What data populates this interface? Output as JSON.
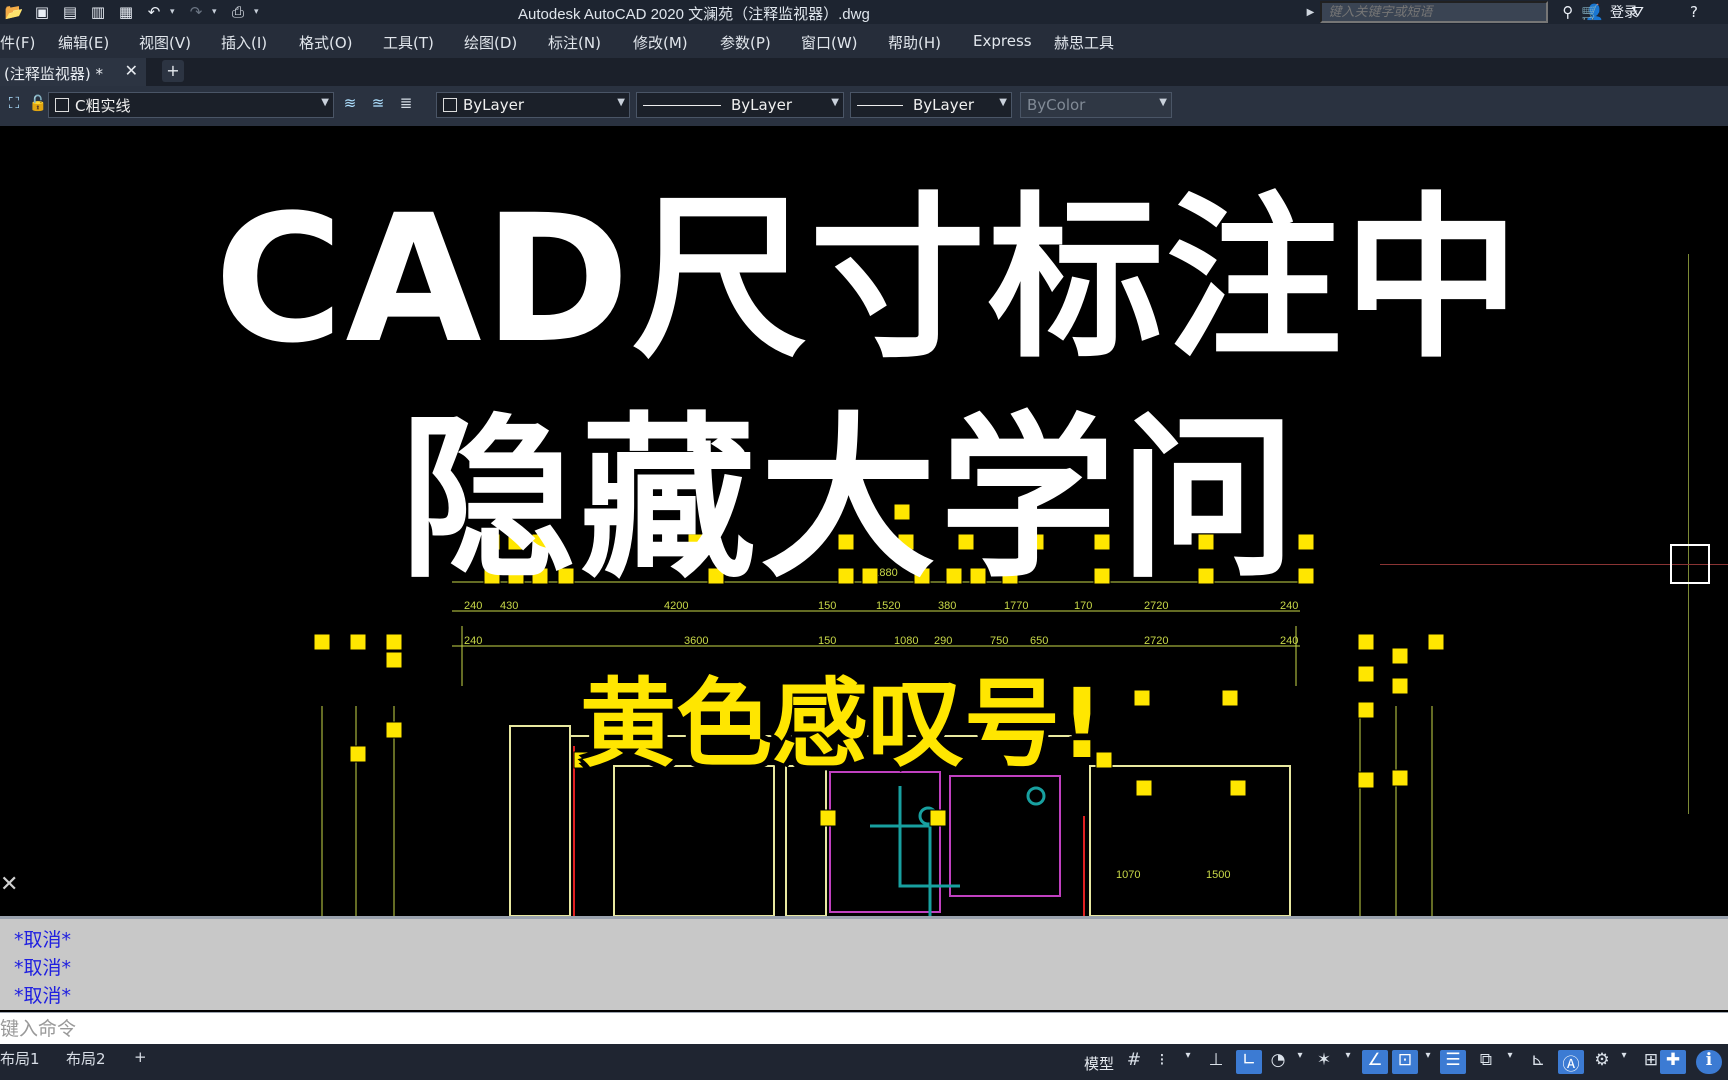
{
  "titlebar": {
    "title": "Autodesk AutoCAD 2020    文澜苑（注释监视器）.dwg",
    "search_placeholder": "键入关键字或短语",
    "login": "登录",
    "icons": [
      "open-icon",
      "save-icon",
      "saveas-icon",
      "plot-preview-icon",
      "publish-icon",
      "undo-icon",
      "redo-icon",
      "print-icon",
      "customize-icon"
    ]
  },
  "menu": {
    "items": [
      "件(F)",
      "编辑(E)",
      "视图(V)",
      "插入(I)",
      "格式(O)",
      "工具(T)",
      "绘图(D)",
      "标注(N)",
      "修改(M)",
      "参数(P)",
      "窗口(W)",
      "帮助(H)",
      "Express",
      "赫思工具"
    ]
  },
  "tabs": {
    "doc_tab": "(注释监视器) *",
    "close": "✕",
    "add": "+"
  },
  "properties": {
    "layer": "C粗实线",
    "color": "ByLayer",
    "linetype": "ByLayer",
    "lineweight": "ByLayer",
    "plotstyle": "ByColor"
  },
  "overlay": {
    "title_line1": "CAD尺寸标注中",
    "title_line2": "隐藏大学问",
    "subtitle": "黄色感叹号!"
  },
  "drawing": {
    "dim_overall": "11880",
    "dim_row1": [
      "240",
      "430",
      "4200",
      "150",
      "1520",
      "380",
      "1770",
      "170",
      "2720",
      "240"
    ],
    "dim_row2": [
      "240",
      "3600",
      "150",
      "1080",
      "290",
      "750",
      "650",
      "2720",
      "240"
    ],
    "dim_room": [
      "1070",
      "1500"
    ],
    "colors": {
      "dim": "#c8d848",
      "warn": "#ffe600",
      "wall": "#e8e8a0",
      "cyan": "#18a0a0",
      "magenta": "#c040c0",
      "red": "#e02020"
    }
  },
  "command": {
    "history": [
      "*取消*",
      "*取消*",
      "*取消*"
    ],
    "placeholder": "键入命令"
  },
  "status": {
    "layouts": [
      "布局1",
      "布局2"
    ],
    "add": "+",
    "model": "模型"
  }
}
